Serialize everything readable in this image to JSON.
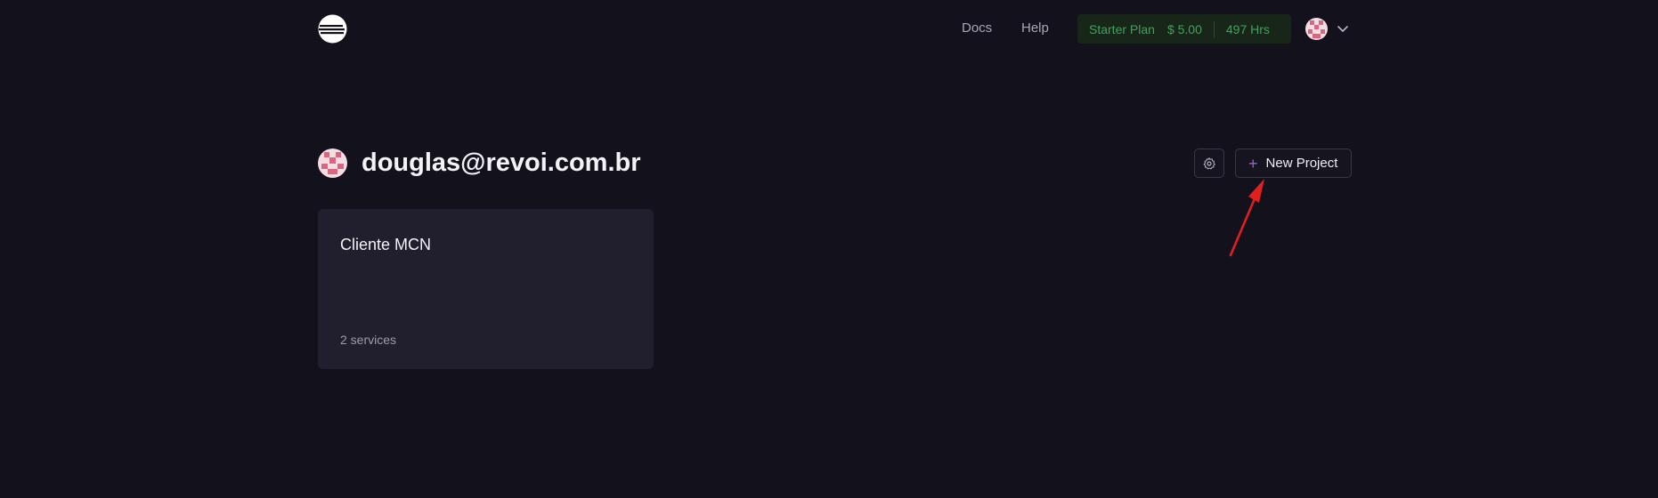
{
  "nav": {
    "docs_label": "Docs",
    "help_label": "Help",
    "plan": {
      "name": "Starter Plan",
      "price": "$ 5.00",
      "hours": "497 Hrs"
    }
  },
  "header": {
    "title": "douglas@revoi.com.br",
    "new_project_label": "New Project"
  },
  "projects": [
    {
      "name": "Cliente MCN",
      "services": "2 services"
    }
  ],
  "colors": {
    "background": "#13111c",
    "card": "#211f2d",
    "plan_green": "#3fa35a",
    "accent_purple": "#a35ad8",
    "annotation_red": "#e0201f"
  },
  "icons": [
    "railway-logo-icon",
    "avatar-icon",
    "chevron-down-icon",
    "gear-icon",
    "plus-icon",
    "annotation-arrow-icon"
  ]
}
